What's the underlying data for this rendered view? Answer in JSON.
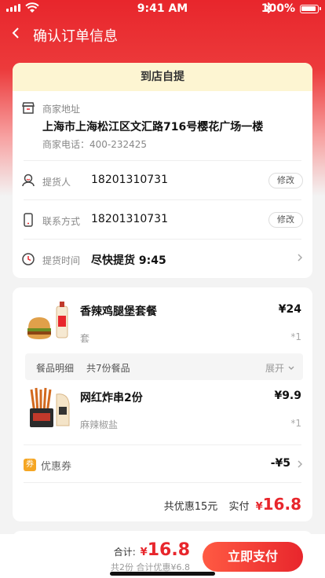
{
  "status_bar": {
    "time": "9:41 AM",
    "battery": "100%"
  },
  "header": {
    "title": "确认订单信息"
  },
  "pickup": {
    "mode": "到店自提",
    "store_label": "商家地址",
    "store_address": "上海市上海松江区文汇路716号樱花广场一楼",
    "store_phone": "商家电话：400-232425",
    "picker_label": "提货人",
    "picker_value": "18201310731",
    "contact_label": "联系方式",
    "contact_value": "18201310731",
    "edit_label": "修改",
    "time_label": "提货时间",
    "time_value": "尽快提货 9:45"
  },
  "items": [
    {
      "name": "香辣鸡腿堡套餐",
      "spec": "套",
      "price": "¥24",
      "qty": "*1"
    },
    {
      "name": "网红炸串2份",
      "spec": "麻辣椒盐",
      "price": "¥9.9",
      "qty": "*1"
    }
  ],
  "detail_bar": {
    "label": "餐品明细",
    "count": "共7份餐品",
    "expand": "展开"
  },
  "coupon": {
    "label": "优惠券",
    "value": "-¥5",
    "icon_char": "券"
  },
  "summary": {
    "discount_text": "共优惠15元",
    "paid_label": "实付",
    "currency": "¥",
    "paid_value": "16.8"
  },
  "footer": {
    "total_label": "合计:",
    "total_currency": "¥",
    "total_value": "16.8",
    "subtotal": "共2份 合计优惠¥6.8",
    "pay_button": "立即支付"
  },
  "colors": {
    "brand_red": "#e8262c",
    "pickup_head_bg": "#fdf5d2"
  }
}
